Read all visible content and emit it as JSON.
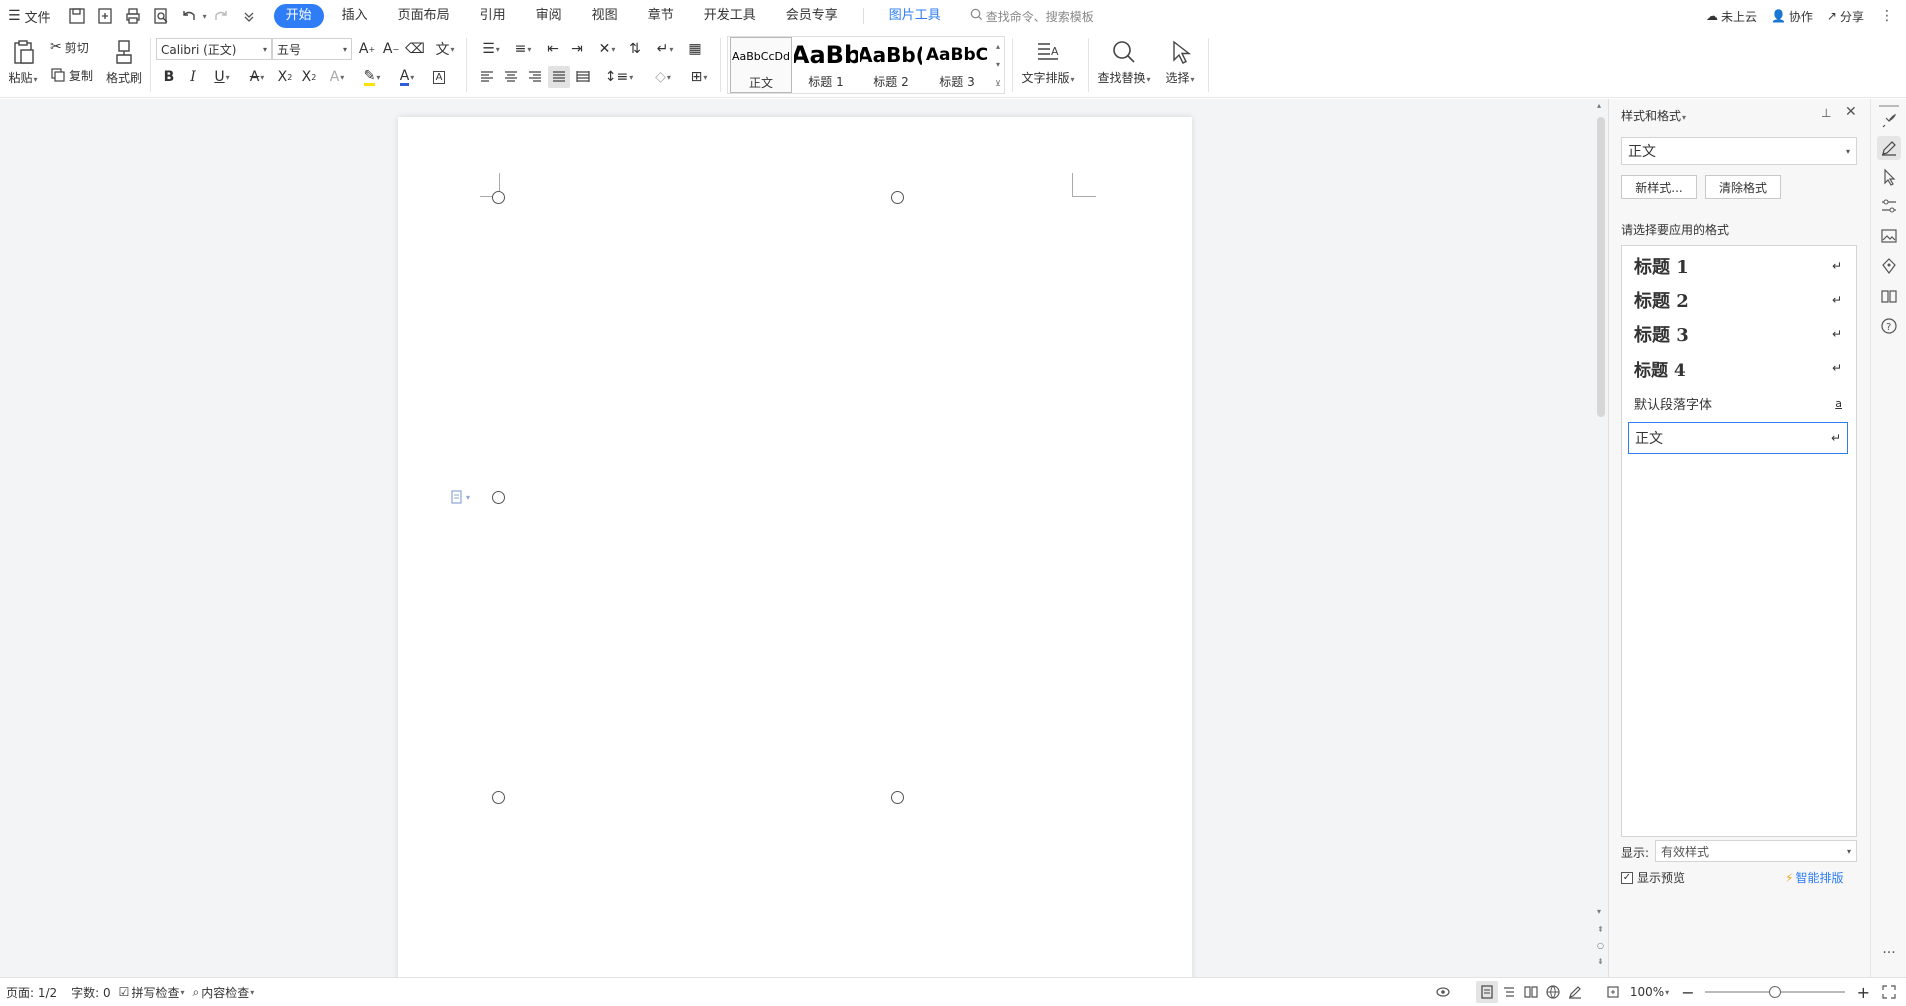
{
  "menubar": {
    "file_label": "文件",
    "tabs": [
      {
        "label": "开始",
        "active": true
      },
      {
        "label": "插入"
      },
      {
        "label": "页面布局"
      },
      {
        "label": "引用"
      },
      {
        "label": "审阅"
      },
      {
        "label": "视图"
      },
      {
        "label": "章节"
      },
      {
        "label": "开发工具"
      },
      {
        "label": "会员专享"
      }
    ],
    "context_tab": "图片工具",
    "search_placeholder": "查找命令、搜索模板",
    "cloud_label": "未上云",
    "collab_label": "协作",
    "share_label": "分享"
  },
  "ribbon": {
    "paste": "粘贴",
    "cut": "剪切",
    "copy": "复制",
    "format_painter": "格式刷",
    "font_name": "Calibri (正文)",
    "font_size": "五号",
    "styles": [
      {
        "preview": "AaBbCcDd",
        "name": "正文"
      },
      {
        "preview": "AaBb",
        "name": "标题 1"
      },
      {
        "preview": "AaBb(",
        "name": "标题 2"
      },
      {
        "preview": "AaBbC",
        "name": "标题 3"
      }
    ],
    "text_layout": "文字排版",
    "find_replace": "查找替换",
    "select": "选择"
  },
  "taskpane": {
    "title": "样式和格式",
    "current_style": "正文",
    "new_style_btn": "新样式...",
    "clear_format_btn": "清除格式",
    "prompt": "请选择要应用的格式",
    "styles": [
      {
        "name": "标题  1",
        "mark": "↵"
      },
      {
        "name": "标题  2",
        "mark": "↵"
      },
      {
        "name": "标题  3",
        "mark": "↵"
      },
      {
        "name": "标题  4",
        "mark": "↵"
      },
      {
        "name": "默认段落字体",
        "mark": "a"
      },
      {
        "name": "正文",
        "mark": "↵"
      }
    ],
    "show_label": "显示:",
    "show_value": "有效样式",
    "preview_label": "显示预览",
    "smart_layout": "智能排版"
  },
  "statusbar": {
    "page": "页面: 1/2",
    "words": "字数: 0",
    "spell_check": "拼写检查",
    "content_check": "内容检查",
    "zoom": "100%",
    "zoom_level": 0.5
  },
  "colors": {
    "accent": "#2e7cf6",
    "workspace": "#f3f4f6",
    "highlight": "#ffe100",
    "font_color": "#2e5bd8"
  }
}
